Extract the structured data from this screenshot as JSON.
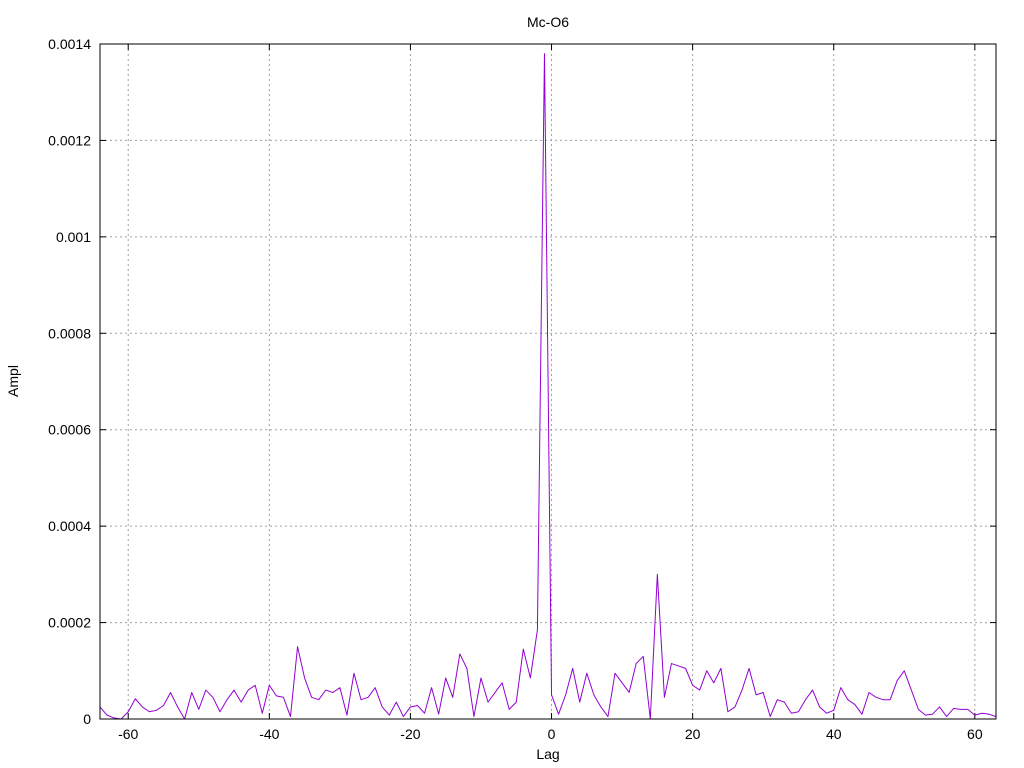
{
  "chart_data": {
    "type": "line",
    "title": "Mc-O6",
    "xlabel": "Lag",
    "ylabel": "Ampl",
    "xlim": [
      -64,
      63
    ],
    "ylim": [
      0,
      0.0014
    ],
    "x_ticks": [
      -60,
      -40,
      -20,
      0,
      20,
      40,
      60
    ],
    "x_tick_labels": [
      "-60",
      "-40",
      "-20",
      "0",
      "20",
      "40",
      "60"
    ],
    "y_ticks": [
      0,
      0.0002,
      0.0004,
      0.0006,
      0.0008,
      0.001,
      0.0012,
      0.0014
    ],
    "y_tick_labels": [
      "0",
      "0.0002",
      "0.0004",
      "0.0006",
      "0.0008",
      "0.001",
      "0.0012",
      "0.0014"
    ],
    "grid": true,
    "series": [
      {
        "color": "#9400d3",
        "x_start": -64,
        "x_step": 1,
        "values": [
          2.5e-05,
          8e-06,
          2e-06,
          0.0,
          1.5e-05,
          4.2e-05,
          2.5e-05,
          1.5e-05,
          1.8e-05,
          2.8e-05,
          5.5e-05,
          2.5e-05,
          0.0,
          5.5e-05,
          2e-05,
          6e-05,
          4.5e-05,
          1.5e-05,
          4e-05,
          6e-05,
          3.5e-05,
          6e-05,
          7e-05,
          1.2e-05,
          7e-05,
          4.8e-05,
          4.5e-05,
          5e-06,
          0.00015,
          8.5e-05,
          4.5e-05,
          4e-05,
          6e-05,
          5.5e-05,
          6.5e-05,
          8e-06,
          9.5e-05,
          4e-05,
          4.5e-05,
          6.5e-05,
          2.5e-05,
          8e-06,
          3.5e-05,
          5e-06,
          2.5e-05,
          2.8e-05,
          1.2e-05,
          6.5e-05,
          1e-05,
          8.5e-05,
          4.5e-05,
          0.000135,
          0.000105,
          5e-06,
          8.5e-05,
          3.5e-05,
          5.5e-05,
          7.5e-05,
          2e-05,
          3.5e-05,
          0.000145,
          8.5e-05,
          0.000185,
          0.00138,
          5e-05,
          1e-05,
          5e-05,
          0.000105,
          3.5e-05,
          9.5e-05,
          5e-05,
          2.5e-05,
          5e-06,
          9.5e-05,
          7.5e-05,
          5.5e-05,
          0.000115,
          0.00013,
          0.0,
          0.0003,
          4.5e-05,
          0.000115,
          0.00011,
          0.000105,
          7e-05,
          6e-05,
          0.0001,
          7.5e-05,
          0.000105,
          1.5e-05,
          2.5e-05,
          6e-05,
          0.000105,
          5e-05,
          5.5e-05,
          5e-06,
          4e-05,
          3.5e-05,
          1.2e-05,
          1.5e-05,
          4e-05,
          6e-05,
          2.5e-05,
          1.2e-05,
          1.8e-05,
          6.5e-05,
          4e-05,
          3e-05,
          1e-05,
          5.5e-05,
          4.5e-05,
          4e-05,
          4e-05,
          8e-05,
          0.0001,
          6e-05,
          2e-05,
          8e-06,
          1e-05,
          2.5e-05,
          5e-06,
          2.2e-05,
          2e-05,
          2e-05,
          8e-06,
          1.2e-05,
          1e-05,
          5e-06
        ]
      }
    ]
  }
}
